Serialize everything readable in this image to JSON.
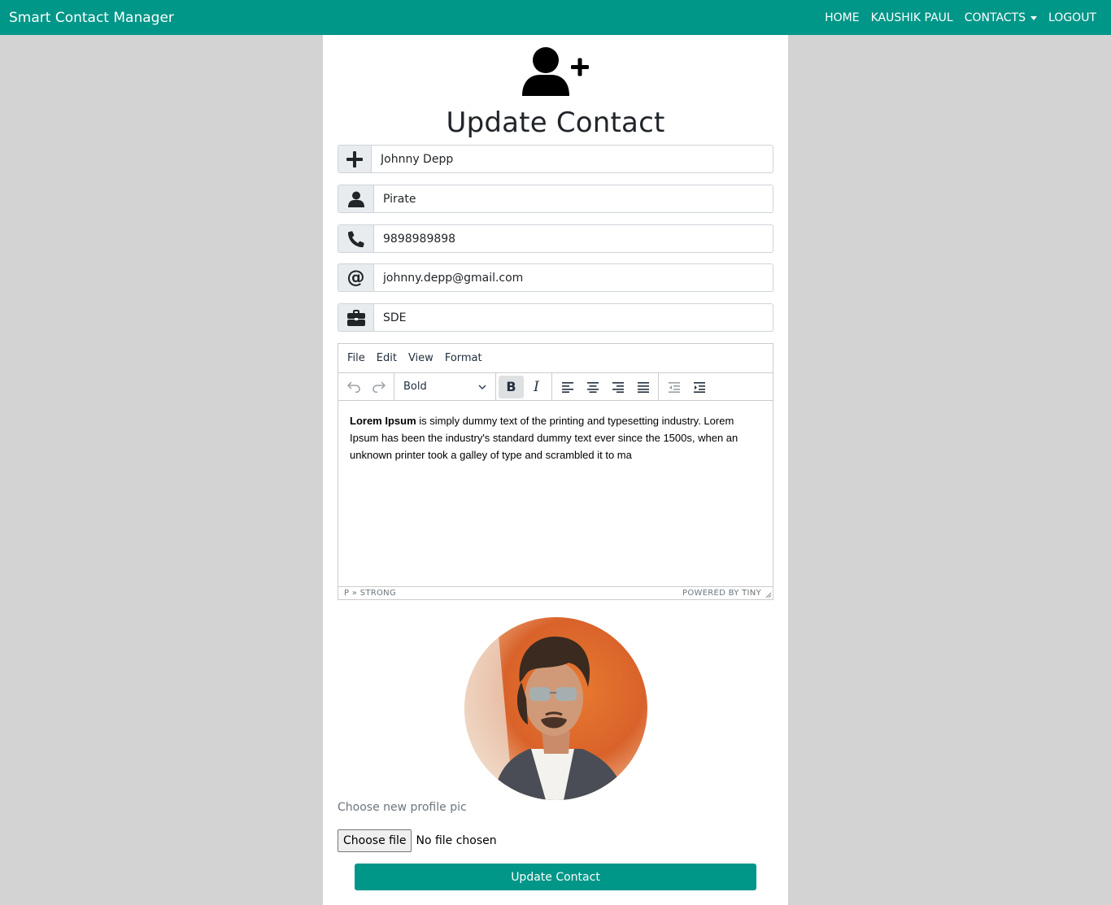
{
  "app": {
    "brand": "Smart Contact Manager"
  },
  "nav": {
    "home": "HOME",
    "user": "KAUSHIK PAUL",
    "contacts": "CONTACTS",
    "logout": "LOGOUT"
  },
  "page": {
    "title": "Update Contact"
  },
  "form": {
    "name": "Johnny Depp",
    "nickname": "Pirate",
    "phone": "9898989898",
    "email": "johnny.depp@gmail.com",
    "work": "SDE"
  },
  "editor": {
    "menu": [
      "File",
      "Edit",
      "View",
      "Format"
    ],
    "block_format": "Bold",
    "content_bold": "Lorem Ipsum",
    "content_rest": " is simply dummy text of the printing and typesetting industry. Lorem Ipsum has been the industry's standard dummy text ever since the 1500s, when an unknown printer took a galley of type and scrambled it to ma",
    "path": "P » STRONG",
    "branding": "POWERED BY TINY"
  },
  "profile": {
    "label": "Choose new profile pic",
    "choose_button": "Choose file",
    "file_status": "No file chosen"
  },
  "actions": {
    "submit": "Update Contact"
  },
  "colors": {
    "primary": "#009688",
    "background": "#d3d3d3"
  }
}
